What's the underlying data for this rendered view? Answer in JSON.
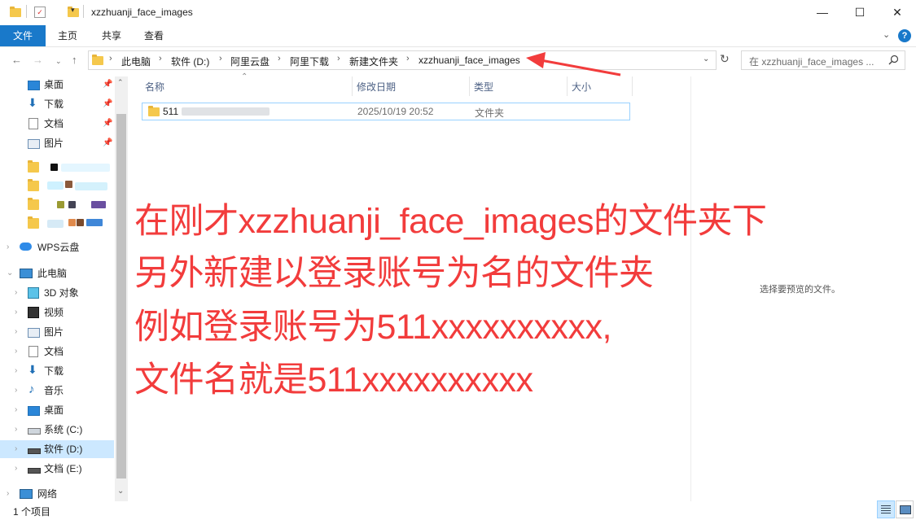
{
  "window": {
    "title": "xzzhuanji_face_images",
    "minimize": "—",
    "maximize": "☐",
    "close": "✕"
  },
  "ribbon": {
    "tabs": [
      {
        "label": "文件"
      },
      {
        "label": "主页"
      },
      {
        "label": "共享"
      },
      {
        "label": "查看"
      }
    ]
  },
  "address": {
    "crumbs": [
      "此电脑",
      "软件 (D:)",
      "阿里云盘",
      "阿里下载",
      "新建文件夹",
      "xzzhuanji_face_images"
    ],
    "search_placeholder": "在 xzzhuanji_face_images ..."
  },
  "navpane": {
    "quick": [
      {
        "label": "桌面"
      },
      {
        "label": "下载"
      },
      {
        "label": "文档"
      },
      {
        "label": "图片"
      }
    ],
    "wps": "WPS云盘",
    "thispc": "此电脑",
    "pc_items": [
      {
        "label": "3D 对象"
      },
      {
        "label": "视频"
      },
      {
        "label": "图片"
      },
      {
        "label": "文档"
      },
      {
        "label": "下载"
      },
      {
        "label": "音乐"
      },
      {
        "label": "桌面"
      },
      {
        "label": "系统 (C:)"
      },
      {
        "label": "软件 (D:)"
      },
      {
        "label": "文档 (E:)"
      }
    ],
    "network": "网络"
  },
  "columns": {
    "name": "名称",
    "modified": "修改日期",
    "type": "类型",
    "size": "大小"
  },
  "files": [
    {
      "name": "511",
      "modified": "2025/10/19 20:52",
      "type": "文件夹"
    }
  ],
  "preview": {
    "empty_text": "选择要预览的文件。"
  },
  "annotation": {
    "lines": [
      "在刚才xzzhuanji_face_images的文件夹下",
      "另外新建以登录账号为名的文件夹",
      "例如登录账号为511xxxxxxxxxx,",
      "文件名就是511xxxxxxxxxx"
    ],
    "color": "#f23c3c"
  },
  "status": {
    "count": "1 个项目"
  },
  "colors": {
    "accent": "#1979ca",
    "selection": "#cce8ff"
  }
}
